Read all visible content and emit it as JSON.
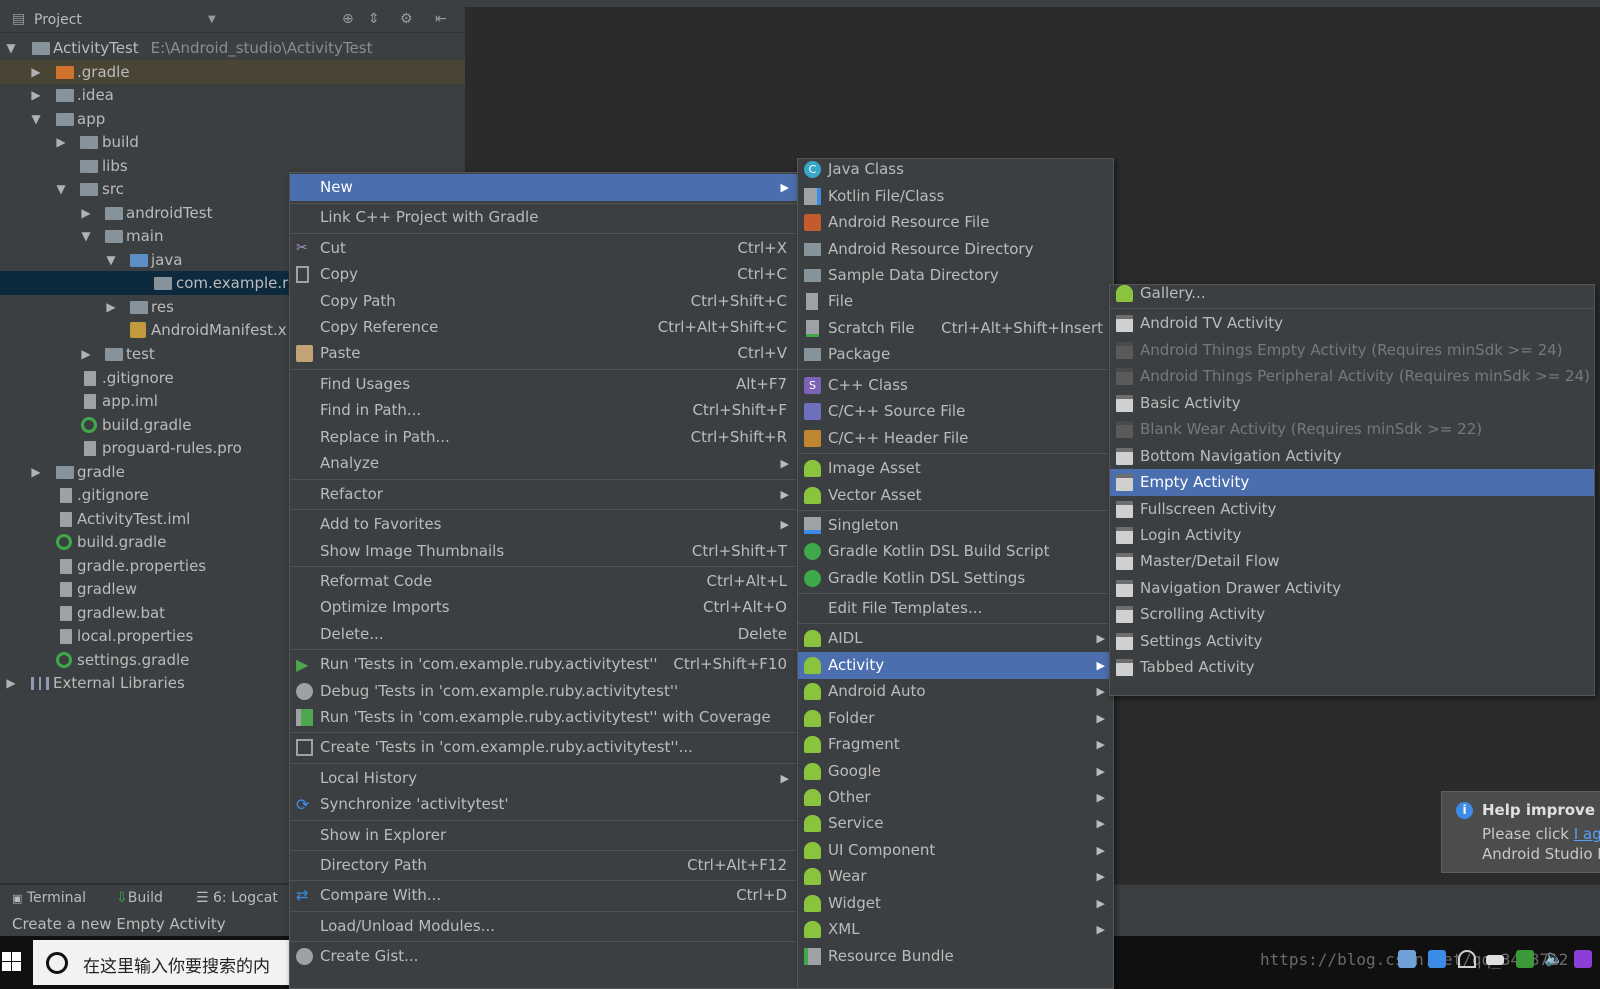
{
  "project_panel": {
    "title": "Project",
    "tree": [
      {
        "label": "ActivityTest",
        "path": "E:\\Android_studio\\ActivityTest"
      },
      {
        "label": ".gradle"
      },
      {
        "label": ".idea"
      },
      {
        "label": "app"
      },
      {
        "label": "build"
      },
      {
        "label": "libs"
      },
      {
        "label": "src"
      },
      {
        "label": "androidTest"
      },
      {
        "label": "main"
      },
      {
        "label": "java"
      },
      {
        "label": "com.example.ru"
      },
      {
        "label": "res"
      },
      {
        "label": "AndroidManifest.x"
      },
      {
        "label": "test"
      },
      {
        "label": ".gitignore"
      },
      {
        "label": "app.iml"
      },
      {
        "label": "build.gradle"
      },
      {
        "label": "proguard-rules.pro"
      },
      {
        "label": "gradle"
      },
      {
        "label": ".gitignore"
      },
      {
        "label": "ActivityTest.iml"
      },
      {
        "label": "build.gradle"
      },
      {
        "label": "gradle.properties"
      },
      {
        "label": "gradlew"
      },
      {
        "label": "gradlew.bat"
      },
      {
        "label": "local.properties"
      },
      {
        "label": "settings.gradle"
      },
      {
        "label": "External Libraries"
      }
    ]
  },
  "tool_tabs": {
    "terminal": "Terminal",
    "build": "Build",
    "logcat": "6: Logcat"
  },
  "status": "Create a new Empty Activity",
  "taskbar": {
    "search_placeholder": "在这里输入你要搜索的内",
    "watermark": "https://blog.csdn.net/qq_3458712"
  },
  "notification": {
    "title": "Help improve Ar",
    "line1_prefix": "Please click ",
    "line1_link": "I agr",
    "line2": "Android Studio I"
  },
  "context_menu": {
    "items": [
      {
        "label": "New",
        "shortcut": "",
        "submenu": true,
        "icon": ""
      },
      {
        "label": "Link C++ Project with Gradle",
        "shortcut": "",
        "icon": ""
      },
      {
        "label": "Cut",
        "shortcut": "Ctrl+X",
        "icon": "scissors-icon"
      },
      {
        "label": "Copy",
        "shortcut": "Ctrl+C",
        "icon": "copy-icon"
      },
      {
        "label": "Copy Path",
        "shortcut": "Ctrl+Shift+C",
        "icon": ""
      },
      {
        "label": "Copy Reference",
        "shortcut": "Ctrl+Alt+Shift+C",
        "icon": ""
      },
      {
        "label": "Paste",
        "shortcut": "Ctrl+V",
        "icon": "paste-icon"
      },
      {
        "label": "Find Usages",
        "shortcut": "Alt+F7",
        "icon": ""
      },
      {
        "label": "Find in Path...",
        "shortcut": "Ctrl+Shift+F",
        "icon": ""
      },
      {
        "label": "Replace in Path...",
        "shortcut": "Ctrl+Shift+R",
        "icon": ""
      },
      {
        "label": "Analyze",
        "shortcut": "",
        "submenu": true,
        "icon": ""
      },
      {
        "label": "Refactor",
        "shortcut": "",
        "submenu": true,
        "icon": ""
      },
      {
        "label": "Add to Favorites",
        "shortcut": "",
        "submenu": true,
        "icon": ""
      },
      {
        "label": "Show Image Thumbnails",
        "shortcut": "Ctrl+Shift+T",
        "icon": ""
      },
      {
        "label": "Reformat Code",
        "shortcut": "Ctrl+Alt+L",
        "icon": ""
      },
      {
        "label": "Optimize Imports",
        "shortcut": "Ctrl+Alt+O",
        "icon": ""
      },
      {
        "label": "Delete...",
        "shortcut": "Delete",
        "icon": ""
      },
      {
        "label": "Run 'Tests in 'com.example.ruby.activitytest''",
        "shortcut": "Ctrl+Shift+F10",
        "icon": "run-icon"
      },
      {
        "label": "Debug 'Tests in 'com.example.ruby.activitytest''",
        "shortcut": "",
        "icon": "debug-icon"
      },
      {
        "label": "Run 'Tests in 'com.example.ruby.activitytest'' with Coverage",
        "shortcut": "",
        "icon": "coverage-icon"
      },
      {
        "label": "Create 'Tests in 'com.example.ruby.activitytest''...",
        "shortcut": "",
        "icon": "create-test-icon"
      },
      {
        "label": "Local History",
        "shortcut": "",
        "submenu": true,
        "icon": ""
      },
      {
        "label": "Synchronize 'activitytest'",
        "shortcut": "",
        "icon": "sync-icon"
      },
      {
        "label": "Show in Explorer",
        "shortcut": "",
        "icon": ""
      },
      {
        "label": "Directory Path",
        "shortcut": "Ctrl+Alt+F12",
        "icon": ""
      },
      {
        "label": "Compare With...",
        "shortcut": "Ctrl+D",
        "icon": "compare-icon"
      },
      {
        "label": "Load/Unload Modules...",
        "shortcut": "",
        "icon": ""
      },
      {
        "label": "Create Gist...",
        "shortcut": "",
        "icon": "github-icon"
      }
    ]
  },
  "new_menu": {
    "items": [
      {
        "label": "Java Class",
        "shortcut": "",
        "icon": "java-class-icon"
      },
      {
        "label": "Kotlin File/Class",
        "shortcut": "",
        "icon": "kotlin-file-icon"
      },
      {
        "label": "Android Resource File",
        "shortcut": "",
        "icon": "resource-file-icon"
      },
      {
        "label": "Android Resource Directory",
        "shortcut": "",
        "icon": "folder-icon"
      },
      {
        "label": "Sample Data Directory",
        "shortcut": "",
        "icon": "folder-icon"
      },
      {
        "label": "File",
        "shortcut": "",
        "icon": "file-icon"
      },
      {
        "label": "Scratch File",
        "shortcut": "Ctrl+Alt+Shift+Insert",
        "icon": "scratch-file-icon"
      },
      {
        "label": "Package",
        "shortcut": "",
        "icon": "package-icon"
      },
      {
        "label": "C++ Class",
        "shortcut": "",
        "icon": "cpp-class-icon"
      },
      {
        "label": "C/C++ Source File",
        "shortcut": "",
        "icon": "cpp-source-icon"
      },
      {
        "label": "C/C++ Header File",
        "shortcut": "",
        "icon": "cpp-header-icon"
      },
      {
        "label": "Image Asset",
        "shortcut": "",
        "icon": "android-icon"
      },
      {
        "label": "Vector Asset",
        "shortcut": "",
        "icon": "android-icon"
      },
      {
        "label": "Singleton",
        "shortcut": "",
        "icon": "singleton-icon"
      },
      {
        "label": "Gradle Kotlin DSL Build Script",
        "shortcut": "",
        "icon": "gradle-icon"
      },
      {
        "label": "Gradle Kotlin DSL Settings",
        "shortcut": "",
        "icon": "gradle-icon"
      },
      {
        "label": "Edit File Templates...",
        "shortcut": "",
        "icon": ""
      },
      {
        "label": "AIDL",
        "submenu": true,
        "icon": "android-icon"
      },
      {
        "label": "Activity",
        "submenu": true,
        "icon": "android-icon"
      },
      {
        "label": "Android Auto",
        "submenu": true,
        "icon": "android-icon"
      },
      {
        "label": "Folder",
        "submenu": true,
        "icon": "android-icon"
      },
      {
        "label": "Fragment",
        "submenu": true,
        "icon": "android-icon"
      },
      {
        "label": "Google",
        "submenu": true,
        "icon": "android-icon"
      },
      {
        "label": "Other",
        "submenu": true,
        "icon": "android-icon"
      },
      {
        "label": "Service",
        "submenu": true,
        "icon": "android-icon"
      },
      {
        "label": "UI Component",
        "submenu": true,
        "icon": "android-icon"
      },
      {
        "label": "Wear",
        "submenu": true,
        "icon": "android-icon"
      },
      {
        "label": "Widget",
        "submenu": true,
        "icon": "android-icon"
      },
      {
        "label": "XML",
        "submenu": true,
        "icon": "android-icon"
      },
      {
        "label": "Resource Bundle",
        "shortcut": "",
        "icon": "resource-bundle-icon"
      }
    ]
  },
  "activity_menu": {
    "items": [
      {
        "label": "Gallery...",
        "icon": "android-icon"
      },
      {
        "label": "Android TV Activity",
        "icon": "template-icon"
      },
      {
        "label": "Android Things Empty Activity (Requires minSdk >= 24)",
        "icon": "template-icon",
        "disabled": true
      },
      {
        "label": "Android Things Peripheral Activity (Requires minSdk >= 24)",
        "icon": "template-icon",
        "disabled": true
      },
      {
        "label": "Basic Activity",
        "icon": "template-icon"
      },
      {
        "label": "Blank Wear Activity (Requires minSdk >= 22)",
        "icon": "template-icon",
        "disabled": true
      },
      {
        "label": "Bottom Navigation Activity",
        "icon": "template-icon"
      },
      {
        "label": "Empty Activity",
        "icon": "template-icon"
      },
      {
        "label": "Fullscreen Activity",
        "icon": "template-icon"
      },
      {
        "label": "Login Activity",
        "icon": "template-icon"
      },
      {
        "label": "Master/Detail Flow",
        "icon": "template-icon"
      },
      {
        "label": "Navigation Drawer Activity",
        "icon": "template-icon"
      },
      {
        "label": "Scrolling Activity",
        "icon": "template-icon"
      },
      {
        "label": "Settings Activity",
        "icon": "template-icon"
      },
      {
        "label": "Tabbed Activity",
        "icon": "template-icon"
      }
    ]
  },
  "colors": {
    "selection": "#4b6eaf",
    "menu_bg": "#3c3f41",
    "editor_bg": "#2b2b2b",
    "android_green": "#8ac33e"
  }
}
